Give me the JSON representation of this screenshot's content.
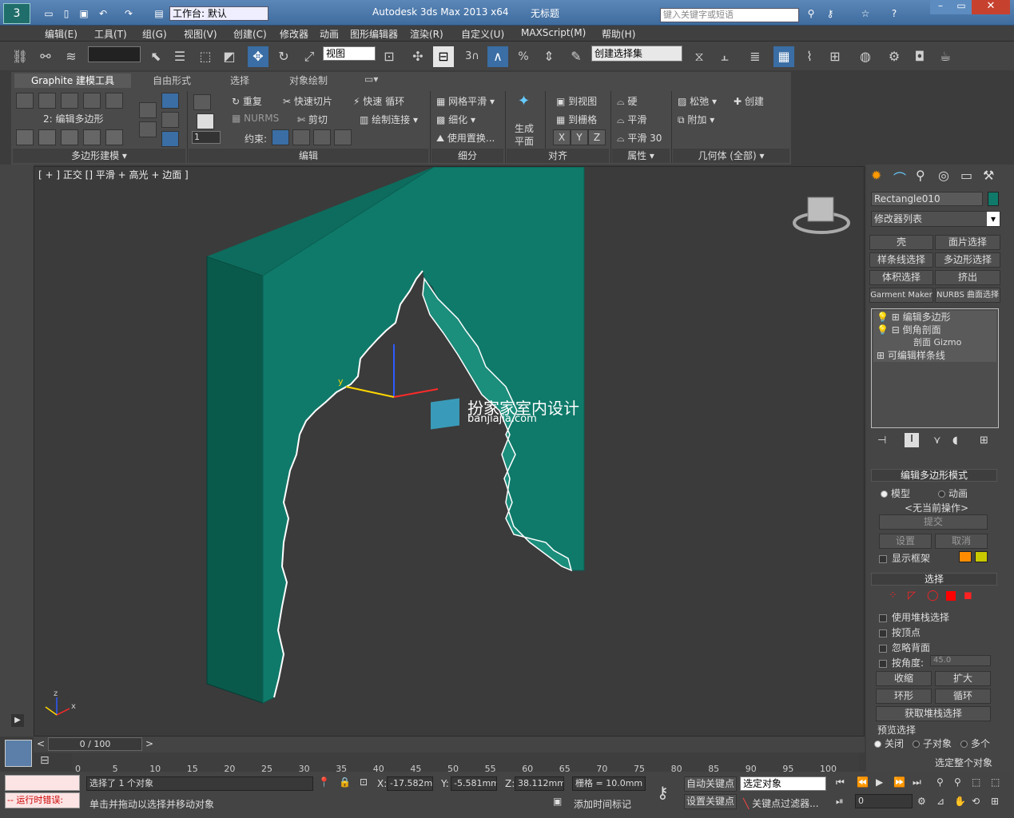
{
  "app": {
    "title": "Autodesk 3ds Max  2013 x64",
    "doc_title": "无标题",
    "workspace": "工作台: 默认",
    "search_placeholder": "键入关键字或短语"
  },
  "menu": [
    "编辑(E)",
    "工具(T)",
    "组(G)",
    "视图(V)",
    "创建(C)",
    "修改器",
    "动画",
    "图形编辑器",
    "渲染(R)",
    "自定义(U)",
    "MAXScript(M)",
    "帮助(H)"
  ],
  "toolbar": {
    "ref_coord": "视图",
    "named_sel": "创建选择集",
    "snap3": "3",
    "snap_pct": "%"
  },
  "ribbon": {
    "tabs": [
      "Graphite 建模工具",
      "自由形式",
      "选择",
      "对象绘制"
    ],
    "sub_label": "2: 编辑多边形",
    "spinner": "1",
    "edit_items": [
      "重复",
      "快速切片",
      "快速 循环",
      "NURMS",
      "剪切",
      "绘制连接"
    ],
    "constraint_label": "约束:",
    "sub_items": [
      "网格平滑",
      "细化",
      "使用置换..."
    ],
    "gen_plane": [
      "生成",
      "平面"
    ],
    "align_items": [
      "到视图",
      "到栅格"
    ],
    "xyz": [
      "X",
      "Y",
      "Z"
    ],
    "prop_items": [
      "硬",
      "平滑",
      "平滑 30"
    ],
    "geo_items": [
      "松弛",
      "创建",
      "附加"
    ],
    "panels": [
      "多边形建模",
      "编辑",
      "细分",
      "对齐",
      "属性",
      "几何体 (全部)"
    ]
  },
  "viewport": {
    "label": "[ + ] 正交 [] 平滑 + 高光 + 边面 ]",
    "watermark_title": "扮家家室内设计",
    "watermark_url": "banjiajia.com",
    "axis_y": "y",
    "axis_z": "z",
    "axis_x": "x"
  },
  "command_panel": {
    "object_name": "Rectangle010",
    "modifier_list": "修改器列表",
    "mod_buttons": [
      "壳",
      "面片选择",
      "样条线选择",
      "多边形选择",
      "体积选择",
      "挤出",
      "Garment Maker",
      "NURBS 曲面选择"
    ],
    "stack": [
      "编辑多边形",
      "倒角剖面",
      "剖面 Gizmo",
      "可编辑样条线"
    ],
    "rollout_mode": "编辑多边形模式",
    "mode_model": "模型",
    "mode_anim": "动画",
    "no_op": "<无当前操作>",
    "commit": "提交",
    "settings": "设置",
    "cancel": "取消",
    "show_cage": "显示框架",
    "rollout_sel": "选择",
    "use_stack": "使用堆栈选择",
    "by_vertex": "按顶点",
    "ignore_back": "忽略背面",
    "by_angle": "按角度:",
    "angle_val": "45.0",
    "shrink": "收缩",
    "grow": "扩大",
    "ring": "环形",
    "loop": "循环",
    "get_stack": "获取堆栈选择",
    "preview_sel": "预览选择",
    "off": "关闭",
    "subobj": "子对象",
    "multi": "多个",
    "whole": "选定整个对象"
  },
  "timeline": {
    "frame": "0 / 100",
    "ticks": [
      "0",
      "5",
      "10",
      "15",
      "20",
      "25",
      "30",
      "35",
      "40",
      "45",
      "50",
      "55",
      "60",
      "65",
      "70",
      "75",
      "80",
      "85",
      "90",
      "95",
      "100"
    ]
  },
  "status": {
    "error": "-- 运行时错误:",
    "selected": "选择了 1 个对象",
    "prompt": "单击并拖动以选择并移动对象",
    "x_label": "X:",
    "x": "-17.582mm",
    "y_label": "Y:",
    "y": "-5.581mm",
    "z_label": "Z:",
    "z": "38.112mm",
    "grid": "栅格 = 10.0mm",
    "add_marker": "添加时间标记",
    "auto_key": "自动关键点",
    "set_key": "设置关键点",
    "key_sel": "选定对象",
    "key_filter": "关键点过滤器...",
    "frame_field": "0"
  },
  "colors": {
    "object": "#0f7a6a",
    "object_dark": "#0a5a4c",
    "selection": "#ff0000",
    "swatch1": "#ff8c00",
    "swatch2": "#c8c800"
  }
}
